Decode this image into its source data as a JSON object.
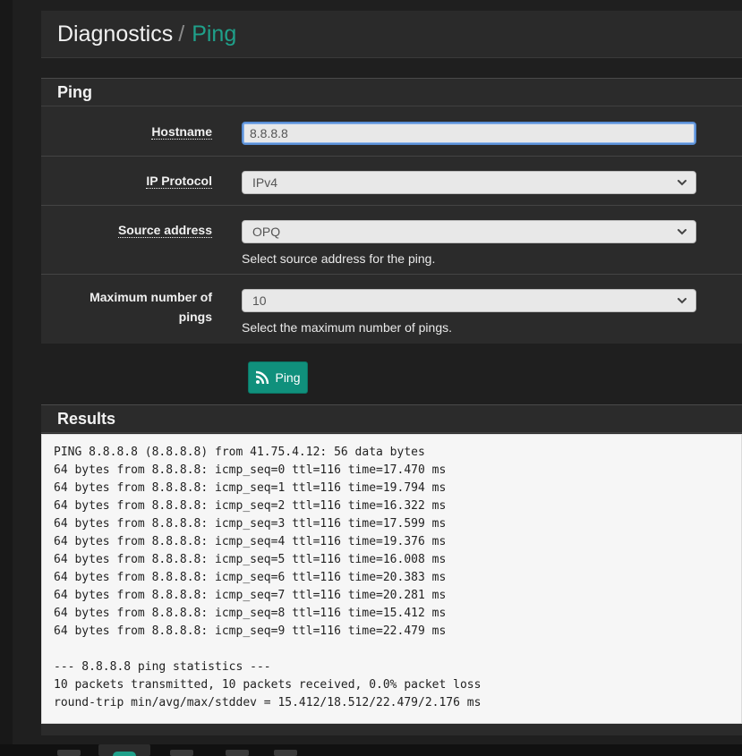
{
  "breadcrumb": {
    "section": "Diagnostics",
    "separator": "/",
    "current": "Ping"
  },
  "ping_panel": {
    "title": "Ping",
    "hostname": {
      "label": "Hostname",
      "value": "8.8.8.8"
    },
    "ip_protocol": {
      "label": "IP Protocol",
      "selected": "IPv4"
    },
    "source_address": {
      "label": "Source address",
      "selected": "OPQ",
      "help": "Select source address for the ping."
    },
    "max_pings": {
      "label_line1": "Maximum number of",
      "label_line2": "pings",
      "selected": "10",
      "help": "Select the maximum number of pings."
    }
  },
  "ping_button": {
    "label": "Ping",
    "icon": "rss-icon"
  },
  "results": {
    "title": "Results",
    "lines": [
      "PING 8.8.8.8 (8.8.8.8) from 41.75.4.12: 56 data bytes",
      "64 bytes from 8.8.8.8: icmp_seq=0 ttl=116 time=17.470 ms",
      "64 bytes from 8.8.8.8: icmp_seq=1 ttl=116 time=19.794 ms",
      "64 bytes from 8.8.8.8: icmp_seq=2 ttl=116 time=16.322 ms",
      "64 bytes from 8.8.8.8: icmp_seq=3 ttl=116 time=17.599 ms",
      "64 bytes from 8.8.8.8: icmp_seq=4 ttl=116 time=19.376 ms",
      "64 bytes from 8.8.8.8: icmp_seq=5 ttl=116 time=16.008 ms",
      "64 bytes from 8.8.8.8: icmp_seq=6 ttl=116 time=20.383 ms",
      "64 bytes from 8.8.8.8: icmp_seq=7 ttl=116 time=20.281 ms",
      "64 bytes from 8.8.8.8: icmp_seq=8 ttl=116 time=15.412 ms",
      "64 bytes from 8.8.8.8: icmp_seq=9 ttl=116 time=22.479 ms",
      "",
      "--- 8.8.8.8 ping statistics ---",
      "10 packets transmitted, 10 packets received, 0.0% packet loss",
      "round-trip min/avg/max/stddev = 15.412/18.512/22.479/2.176 ms"
    ]
  },
  "colors": {
    "accent": "#10907c",
    "breadcrumb_current": "#1fa08a",
    "panel_bg": "#2b2b2b",
    "page_bg": "#1f1f1f"
  }
}
